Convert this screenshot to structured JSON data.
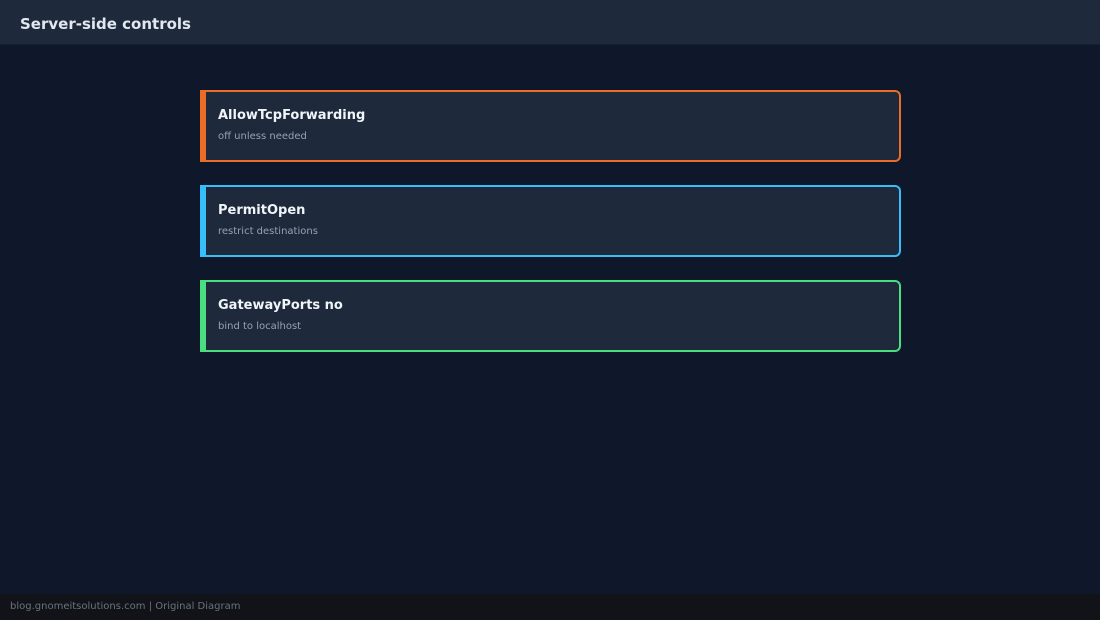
{
  "header": {
    "title": "Server-side controls"
  },
  "cards": [
    {
      "title": "AllowTcpForwarding",
      "description": "off unless needed",
      "accent": "#ea6c26"
    },
    {
      "title": "PermitOpen",
      "description": "restrict destinations",
      "accent": "#38bdf8"
    },
    {
      "title": "GatewayPorts no",
      "description": "bind to localhost",
      "accent": "#4ade80"
    }
  ],
  "footer": {
    "text": "blog.gnomeitsolutions.com | Original Diagram"
  },
  "colors": {
    "background": "#0f172a",
    "header": "#1e293b",
    "card": "#1e293b"
  }
}
